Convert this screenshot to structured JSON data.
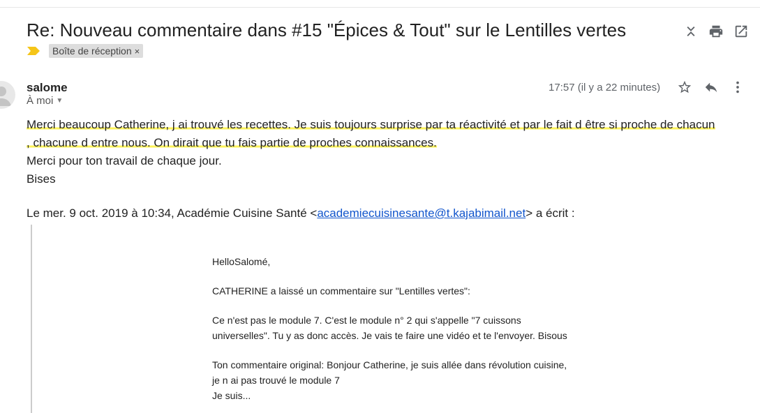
{
  "header": {
    "subject": "Re: Nouveau commentaire dans #15 \"Épices & Tout\" sur le Lentilles vertes",
    "label_chip": "Boîte de réception",
    "label_close": "×"
  },
  "message": {
    "sender": "salome",
    "recipient": "À moi",
    "time": "17:57 (il y a 22 minutes)",
    "body": {
      "line1": "Merci beaucoup Catherine, j ai trouvé les recettes. Je suis toujours surprise par ta réactivité et par le fait d être si proche de chacun",
      "line2": ", chacune d entre nous. On dirait que tu fais partie de proches connaissances.",
      "line3": "Merci pour ton travail de chaque jour.",
      "line4": "Bises"
    },
    "quote_intro": {
      "prefix": "Le mer. 9 oct. 2019 à 10:34, Académie Cuisine Santé <",
      "email": "academiecuisinesante@t.kajabimail.net",
      "suffix": "> a écrit :"
    },
    "quoted": {
      "greeting": "HelloSalomé,",
      "p1": "CATHERINE a laissé un commentaire sur \"Lentilles vertes\":",
      "p2a": "Ce n'est pas le module 7. C'est le module n° 2 qui s'appelle \"7 cuissons",
      "p2b": "universelles\". Tu y as donc accès. Je vais te faire une vidéo et te l'envoyer. Bisous",
      "p3a": "Ton commentaire original: Bonjour Catherine, je suis allée dans révolution cuisine,",
      "p3b": "je n ai pas trouvé le module 7",
      "p3c": "Je suis..."
    }
  },
  "icons": {
    "collapse": "collapse-all-icon",
    "print": "print-icon",
    "open_new": "open-new-window-icon",
    "important": "important-marker-icon",
    "star": "star-icon",
    "reply": "reply-icon",
    "more": "more-vert-icon",
    "avatar": "avatar-icon"
  },
  "colors": {
    "highlight": "#fdf35a",
    "important": "#f5c518",
    "link": "#1155cc"
  }
}
